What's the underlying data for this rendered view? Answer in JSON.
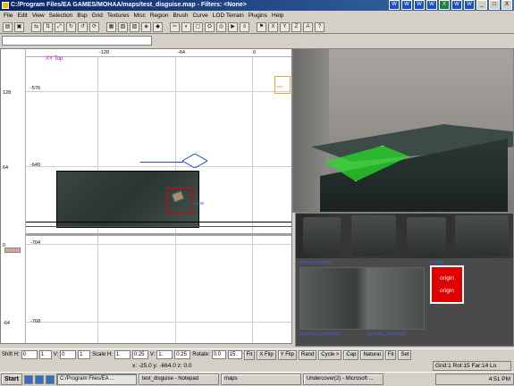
{
  "window": {
    "title": "C:/Program Files/EA GAMES/MOHAA/maps/test_disguise.map - Filters: <None>"
  },
  "tray_icons": [
    "W",
    "W",
    "W",
    "W",
    "X",
    "W",
    "W",
    "_",
    "□",
    "X"
  ],
  "menubar": [
    "File",
    "Edit",
    "View",
    "Selection",
    "Bsp",
    "Grid",
    "Textures",
    "Misc",
    "Region",
    "Brush",
    "Curve",
    "LOD Terrain",
    "Plugins",
    "Help"
  ],
  "toolbar_icons": [
    "open-icon",
    "save-icon",
    "flip-x-icon",
    "flip-y-icon",
    "flip-z-icon",
    "rotate-x-icon",
    "rotate-y-icon",
    "rotate-z-icon",
    "select-complete-icon",
    "select-touching-icon",
    "select-inside-icon",
    "csg-subtract-icon",
    "csg-merge-icon",
    "clipper-icon",
    "view-change-icon",
    "cube-clip-icon",
    "texture-lock-icon",
    "camera-icon",
    "entity-icon",
    "patch-icon",
    "filter-icon",
    "x-icon",
    "y-icon",
    "z-icon",
    "brush-a-icon",
    "help-icon"
  ],
  "toolbar_glyphs": [
    "▤",
    "▣",
    "⇆",
    "⇅",
    "⤢",
    "↻",
    "↺",
    "⟳",
    "▦",
    "▧",
    "▨",
    "◈",
    "◆",
    "✂",
    "◐",
    "▢",
    "⛭",
    "◎",
    "▶",
    "≡",
    "⚑",
    "X",
    "Y",
    "Z",
    "A",
    "?"
  ],
  "xyview": {
    "view_label": "XY Top",
    "h_ticks": [
      "-128",
      "-64",
      "0"
    ],
    "v_ticks": [
      "128",
      "-576",
      "64",
      "-640",
      "0",
      "-704",
      "-64",
      "-768"
    ],
    "entity_label": "model",
    "orange_label": "light"
  },
  "texture_browser": {
    "row_labels": [
      "(officer_uniform)",
      "(origin)"
    ],
    "bottom_labels": [
      "(german_lockerside)",
      "(german_lockertall)"
    ],
    "origin_text": [
      "origin",
      "origin"
    ]
  },
  "statusbar": {
    "shift_h_label": "Shift H:",
    "shift_h": "0",
    "shift_h_step": "1",
    "v_label": "V:",
    "v": "0",
    "v_step": "1",
    "scale_h_label": "Scale H:",
    "scale_h": "1.",
    "scale_h_step": "0.25",
    "scale_v_label": "V:",
    "scale_v": "1.",
    "scale_v_step": "0.25",
    "rotate_label": "Rotate:",
    "rotate": "0.0",
    "rotate_step": "15.",
    "buttons": [
      "Fit",
      "X Flip",
      "Y Flip",
      "Rand",
      "Cycle >",
      "Cap",
      "Natural",
      "Fit",
      "Set"
    ]
  },
  "coords": {
    "x_label": "x:",
    "x": "-25.0",
    "y_label": "y:",
    "y": "-664.0",
    "z_label": "z:",
    "z": "0.0"
  },
  "grid_info": "Grid:1  Rot:15  Far:14  Lo",
  "taskbar": {
    "start": "Start",
    "tasks": [
      "C:/Program Files/EA ...",
      "test_disguise - Notepad",
      "maps",
      "Undercover(2) - Microsoft ..."
    ],
    "active_task": 0,
    "clock": "4:51 PM"
  }
}
